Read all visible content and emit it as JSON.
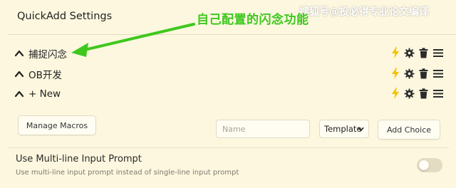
{
  "panel": {
    "title": "QuickAdd Settings"
  },
  "annotation": {
    "text": "自己配置的闪念功能",
    "color": "#3ec81e"
  },
  "watermark": {
    "text": "搜狐号@投必得专业论文编译"
  },
  "choices": [
    {
      "label": "捕捉闪念",
      "icons": [
        "lightning-icon",
        "gear-icon",
        "trash-icon",
        "menu-icon"
      ]
    },
    {
      "label": "OB开发",
      "icons": [
        "lightning-icon",
        "gear-icon",
        "trash-icon",
        "menu-icon"
      ]
    },
    {
      "label": "+ New",
      "icons": [
        "lightning-icon",
        "gear-icon",
        "trash-icon",
        "menu-icon"
      ]
    }
  ],
  "controls": {
    "manage_macros_label": "Manage Macros",
    "name_placeholder": "Name",
    "name_value": "",
    "type_selected": "Template",
    "add_choice_label": "Add Choice"
  },
  "setting": {
    "name": "Use Multi-line Input Prompt",
    "description": "Use multi-line input prompt instead of single-line input prompt",
    "enabled": false
  },
  "colors": {
    "background": "#fdf7df",
    "lightning": "#f2c200",
    "icon_dark": "#2b2b2b",
    "annotation_green": "#3ec81e"
  }
}
